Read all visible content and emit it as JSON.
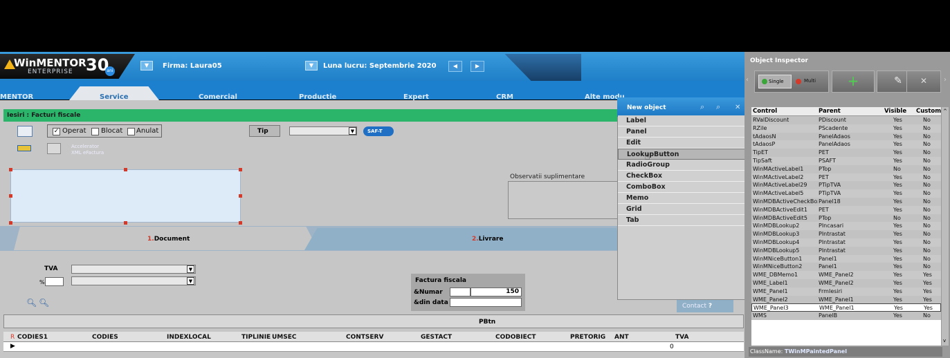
{
  "app": {
    "logo_text": "WinMENTOR",
    "logo_sub": "ENTERPRISE",
    "logo_30": "30",
    "logo_ani": "ani",
    "firma_label": "Firma:",
    "firma_value": "Laura05",
    "luna_label": "Luna lucru:",
    "luna_value": "Septembrie 2020"
  },
  "menu": [
    "MENTOR",
    "Service",
    "Comercial",
    "Productie",
    "Expert",
    "CRM",
    "Alte modu"
  ],
  "form": {
    "title": "Iesiri : Facturi fiscale",
    "cb_operat": "Operat",
    "cb_blocat": "Blocat",
    "cb_anulat": "Anulat",
    "tip_label": "Tip",
    "saft": "SAF-T",
    "accelerator1": "Accelerator",
    "accelerator2": "XML eFactura",
    "observatii": "Observatii suplimentare",
    "tab1_num": "1.",
    "tab1": "Document",
    "tab2_num": "2.",
    "tab2": "Livrare",
    "tva_label": "TVA",
    "pct_label": "%",
    "fiscal_title": "Factura fiscala",
    "numar_label": "&Numar",
    "numar_value": "150",
    "data_label": "&din data",
    "pbtn": "PBtn",
    "grid_flag": "R",
    "grid_cols": [
      "CODIES1",
      "CODIES",
      "INDEXLOCAL",
      "TIPLINIE",
      "UMSEC",
      "CONTSERV",
      "GESTACT",
      "CODOBIECT",
      "PRETORIG",
      "ANT",
      "TVA"
    ],
    "grid_zero": "0",
    "contact": "Contact"
  },
  "new_object": {
    "title": "New object",
    "items": [
      "Label",
      "Panel",
      "Edit",
      "LookupButton",
      "RadioGroup",
      "CheckBox",
      "ComboBox",
      "Memo",
      "Grid",
      "Tab"
    ],
    "selected": "LookupButton"
  },
  "inspector": {
    "title": "Object Inspector",
    "single": "Single",
    "multi": "Multi",
    "headers": [
      "Control",
      "Parent",
      "Visible",
      "Custom"
    ],
    "rows": [
      [
        "RValDiscount",
        "PDiscount",
        "Yes",
        "No"
      ],
      [
        "RZile",
        "PScadente",
        "Yes",
        "No"
      ],
      [
        "tAdaosN",
        "PanelAdaos",
        "Yes",
        "No"
      ],
      [
        "tAdaosP",
        "PanelAdaos",
        "Yes",
        "No"
      ],
      [
        "TipET",
        "PET",
        "Yes",
        "No"
      ],
      [
        "TipSaft",
        "PSAFT",
        "Yes",
        "No"
      ],
      [
        "WinMActiveLabel1",
        "PTop",
        "No",
        "No"
      ],
      [
        "WinMActiveLabel2",
        "PET",
        "Yes",
        "No"
      ],
      [
        "WinMActiveLabel29",
        "PTipTVA",
        "Yes",
        "No"
      ],
      [
        "WinMActiveLabel5",
        "PTipTVA",
        "Yes",
        "No"
      ],
      [
        "WinMDBActiveCheckBox",
        "Panel18",
        "Yes",
        "No"
      ],
      [
        "WinMDBActiveEdit1",
        "PET",
        "Yes",
        "No"
      ],
      [
        "WinMDBActiveEdit5",
        "PTop",
        "No",
        "No"
      ],
      [
        "WinMDBLookup2",
        "PIncasari",
        "Yes",
        "No"
      ],
      [
        "WinMDBLookup3",
        "PIntrastat",
        "Yes",
        "No"
      ],
      [
        "WinMDBLookup4",
        "PIntrastat",
        "Yes",
        "No"
      ],
      [
        "WinMDBLookup5",
        "PIntrastat",
        "Yes",
        "No"
      ],
      [
        "WinMNiceButton1",
        "Panel1",
        "Yes",
        "No"
      ],
      [
        "WinMNiceButton2",
        "Panel1",
        "Yes",
        "No"
      ],
      [
        "WME_DBMemo1",
        "WME_Panel2",
        "Yes",
        "Yes"
      ],
      [
        "WME_Label1",
        "WME_Panel2",
        "Yes",
        "Yes"
      ],
      [
        "WME_Panel1",
        "FrmIesiri",
        "Yes",
        "Yes"
      ],
      [
        "WME_Panel2",
        "WME_Panel1",
        "Yes",
        "Yes"
      ],
      [
        "WME_Panel3",
        "WME_Panel1",
        "Yes",
        "Yes"
      ],
      [
        "WMS",
        "PanelB",
        "Yes",
        "No"
      ]
    ],
    "selected_row": "WME_Panel3",
    "classname_label": "ClassName:",
    "classname_value": "TWinMPaintedPanel"
  },
  "colors": {
    "accent": "#1d80ce",
    "title_green": "#2ab56b",
    "selection": "#d43a2a"
  }
}
